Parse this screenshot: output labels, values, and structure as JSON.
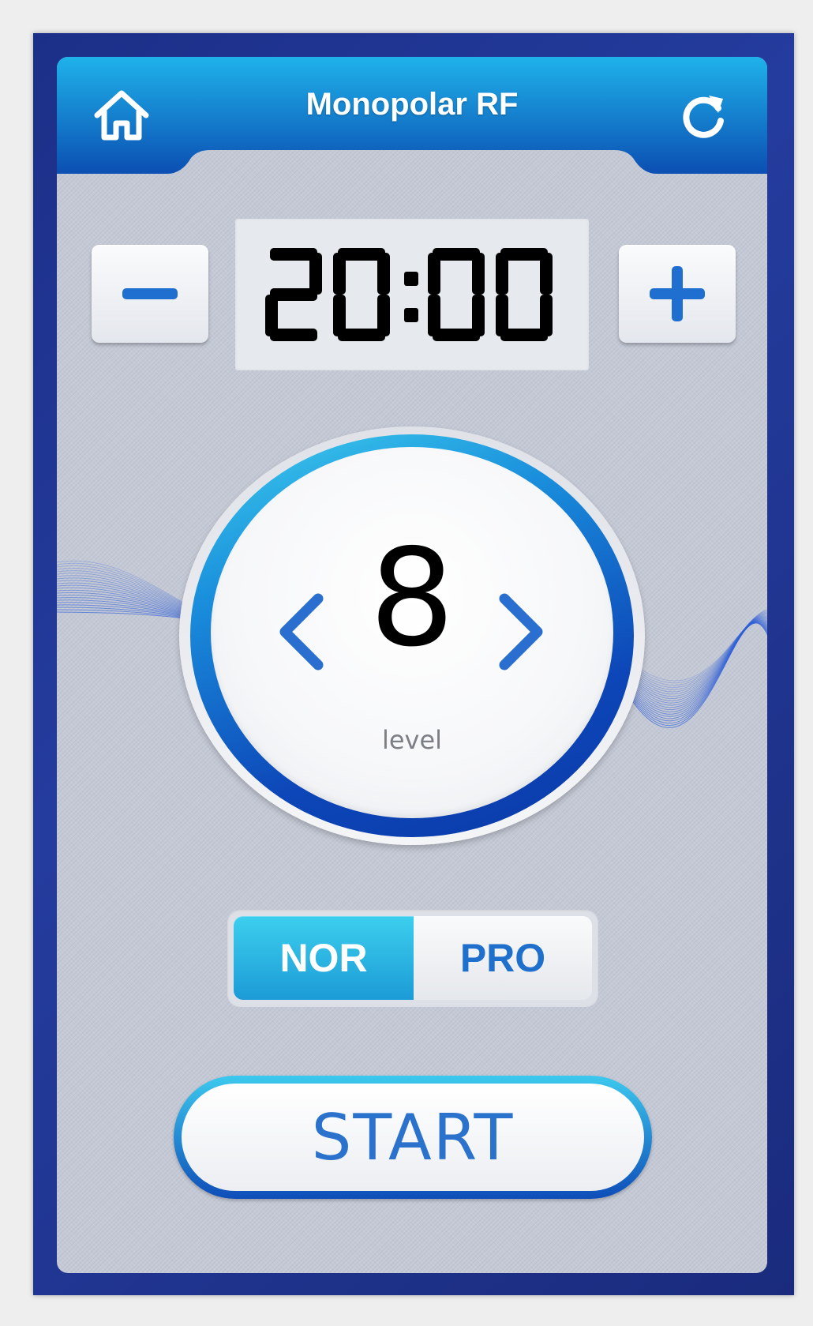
{
  "header": {
    "title": "Monopolar RF",
    "left_icon": "home-icon",
    "right_icon": "refresh-icon"
  },
  "timer": {
    "value": "20:00",
    "minus_icon": "minus-icon",
    "plus_icon": "plus-icon"
  },
  "level": {
    "value": "8",
    "label": "level",
    "prev_icon": "chevron-left-icon",
    "next_icon": "chevron-right-icon"
  },
  "mode": {
    "options": [
      "NOR",
      "PRO"
    ],
    "selected": "NOR"
  },
  "start": {
    "label": "START"
  },
  "colors": {
    "frame": "#1f3390",
    "accent": "#2a72cc",
    "header_top": "#1a9fe0",
    "header_bottom": "#0d56b8",
    "selected_mode": "#2bb4e4"
  }
}
